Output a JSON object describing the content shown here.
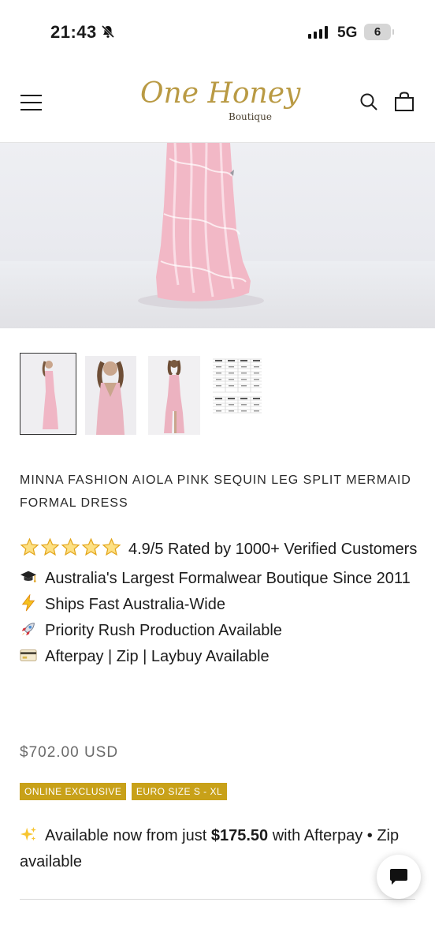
{
  "status_bar": {
    "time": "21:43",
    "network": "5G",
    "battery": "6"
  },
  "header": {
    "logo_main": "One Honey",
    "logo_sub": "Boutique"
  },
  "product": {
    "title": "MINNA FASHION AIOLA PINK SEQUIN LEG SPLIT MERMAID FORMAL DRESS",
    "features": [
      {
        "icon": "stars-icon",
        "text": "4.9/5 Rated by 1000+ Verified Customers"
      },
      {
        "icon": "graduation-cap-icon",
        "text": "Australia's Largest Formalwear Boutique Since 2011"
      },
      {
        "icon": "lightning-icon",
        "text": "Ships Fast Australia-Wide"
      },
      {
        "icon": "rocket-icon",
        "text": "Priority Rush Production Available"
      },
      {
        "icon": "credit-card-icon",
        "text": "Afterpay | Zip | Laybuy Available"
      }
    ],
    "price": "$702.00 USD",
    "badges": [
      "ONLINE EXCLUSIVE",
      "EURO SIZE S - XL"
    ],
    "afterpay": {
      "prefix": "Available now from just ",
      "amount": "$175.50",
      "suffix": " with Afterpay • Zip available"
    }
  },
  "colors": {
    "accent": "#c8a119",
    "logo_gold": "#b99a44",
    "dress_pink": "#f2b8c6"
  }
}
